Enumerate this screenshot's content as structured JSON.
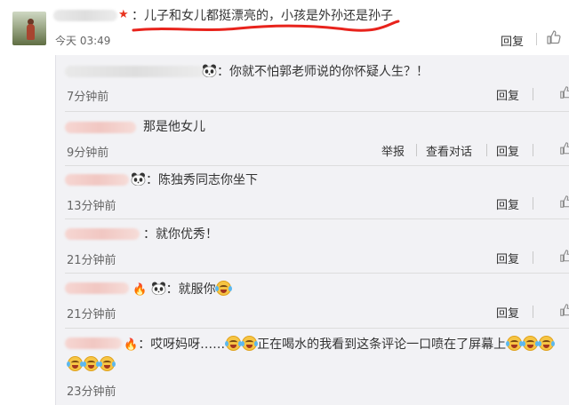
{
  "main_comment": {
    "text": "：儿子和女儿都挺漂亮的，小孩是外孙还是孙子",
    "time": "今天 03:49",
    "reply_label": "回复"
  },
  "replies": [
    {
      "text": "你就不怕郭老师说的你怀疑人生？！",
      "time": "7分钟前",
      "actions": [
        "回复"
      ]
    },
    {
      "text": "那是他女儿",
      "time": "9分钟前",
      "actions": [
        "举报",
        "查看对话",
        "回复"
      ]
    },
    {
      "text": "陈独秀同志你坐下",
      "time": "13分钟前",
      "actions": [
        "回复"
      ]
    },
    {
      "text": "：就你优秀！",
      "time": "21分钟前",
      "actions": [
        "回复"
      ]
    },
    {
      "text": "就服你",
      "time": "21分钟前",
      "actions": [
        "回复"
      ]
    },
    {
      "text_a": "哎呀妈呀……",
      "text_b": "正在喝水的我看到这条评论一口喷在了屏幕上",
      "time": "23分钟前"
    }
  ],
  "colors": {
    "star": "#e8331f",
    "underline": "#e8231c",
    "panel_bg": "#f2f2f5"
  },
  "icons": [
    "avatar",
    "vip-star-icon",
    "thumbs-up-icon",
    "panda-emoji-icon",
    "laughing-crying-emoji-icon",
    "fire-emoji-icon"
  ]
}
